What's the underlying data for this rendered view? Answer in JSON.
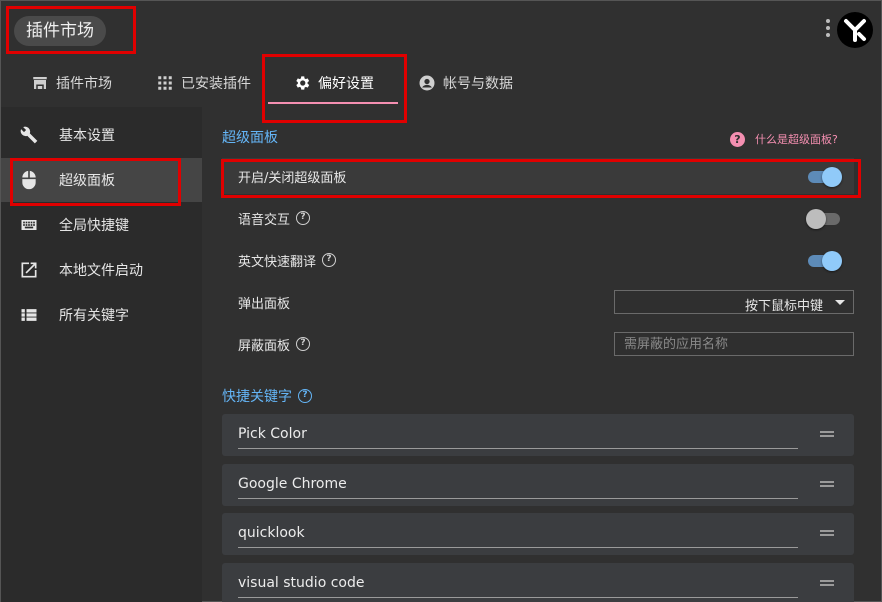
{
  "app": {
    "title": "插件市场"
  },
  "tabs": [
    {
      "label": "插件市场",
      "icon": "store-icon"
    },
    {
      "label": "已安装插件",
      "icon": "grid-icon"
    },
    {
      "label": "偏好设置",
      "icon": "gear-icon",
      "active": true
    },
    {
      "label": "帐号与数据",
      "icon": "account-circle-icon"
    }
  ],
  "sidebar": {
    "items": [
      {
        "label": "基本设置",
        "icon": "wrench-icon"
      },
      {
        "label": "超级面板",
        "icon": "mouse-icon",
        "active": true
      },
      {
        "label": "全局快捷键",
        "icon": "keyboard-icon"
      },
      {
        "label": "本地文件启动",
        "icon": "open-in-new-icon"
      },
      {
        "label": "所有关键字",
        "icon": "list-icon"
      }
    ]
  },
  "main": {
    "section_title": "超级面板",
    "help_link": "什么是超级面板?",
    "settings": {
      "toggle_panel": {
        "label": "开启/关闭超级面板",
        "on": true
      },
      "voice": {
        "label": "语音交互",
        "on": false
      },
      "translate": {
        "label": "英文快速翻译",
        "on": true
      },
      "popup": {
        "label": "弹出面板",
        "value": "按下鼠标中键"
      },
      "block": {
        "label": "屏蔽面板",
        "placeholder": "需屏蔽的应用名称"
      }
    },
    "keywords_title": "快捷关键字",
    "keywords": [
      "Pick Color",
      "Google Chrome",
      "quicklook",
      "visual studio code"
    ]
  },
  "colors": {
    "accent_blue": "#64b5f6",
    "accent_pink": "#f48fb1",
    "highlight_red": "#e00000"
  }
}
